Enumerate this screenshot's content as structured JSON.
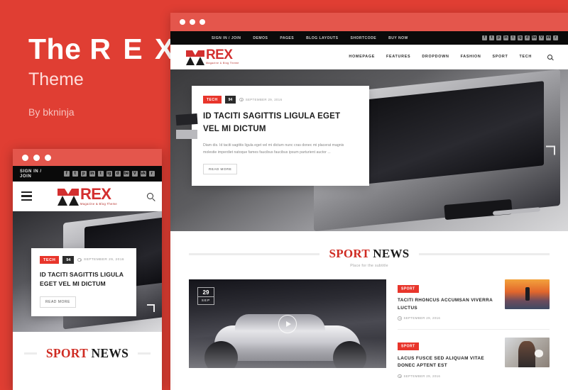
{
  "promo": {
    "title_main": "The",
    "title_brand": "R E X",
    "subtitle": "Theme",
    "author": "By bkninja"
  },
  "colors": {
    "brand_red": "#e03e33",
    "accent_red": "#e8352b",
    "logo_red": "#d32f2f",
    "dark_bar": "#0a0a0a",
    "heading_red": "#cf2b22"
  },
  "site": {
    "logo": {
      "word": "REX",
      "tagline": "Magazine & Blog Theme",
      "mark": "rex-mountain-mark"
    },
    "topbar": {
      "links": [
        {
          "label": "SIGN IN / JOIN"
        },
        {
          "label": "DEMOS"
        },
        {
          "label": "PAGES"
        },
        {
          "label": "BLOG LAYOUTS"
        },
        {
          "label": "SHORTCODE"
        },
        {
          "label": "BUY NOW"
        }
      ],
      "mobile_signin": "SIGN IN / JOIN",
      "social": [
        {
          "name": "facebook-icon",
          "glyph": "f"
        },
        {
          "name": "twitter-icon",
          "glyph": "t"
        },
        {
          "name": "pinterest-icon",
          "glyph": "p"
        },
        {
          "name": "linkedin-icon",
          "glyph": "in"
        },
        {
          "name": "tumblr-icon",
          "glyph": "t"
        },
        {
          "name": "instagram-icon",
          "glyph": "ig"
        },
        {
          "name": "dribbble-icon",
          "glyph": "d"
        },
        {
          "name": "behance-icon",
          "glyph": "be"
        },
        {
          "name": "vimeo-icon",
          "glyph": "V"
        },
        {
          "name": "vk-icon",
          "glyph": "vk"
        },
        {
          "name": "rss-icon",
          "glyph": "r"
        }
      ]
    },
    "mainnav": [
      {
        "label": "HOMEPAGE"
      },
      {
        "label": "FEATURES"
      },
      {
        "label": "DROPDOWN"
      },
      {
        "label": "FASHION"
      },
      {
        "label": "SPORT"
      },
      {
        "label": "TECH"
      }
    ],
    "search_label": "search-icon"
  },
  "hero": {
    "category": "TECH",
    "score": "94",
    "date": "SEPTEMBER 29, 2016",
    "title": "ID TACITI SAGITTIS LIGULA EGET VEL MI DICTUM",
    "excerpt": "Diam dis. Id taciti sagittis ligula eget vel mi dictum nunc cras donec mi placerat magnis molestie imperdiet natoque fames faucibus faucibus ipsum parturient auctor ...",
    "read_more": "READ MORE",
    "next_arrow": "chevron-right-icon"
  },
  "section": {
    "title_red": "SPORT",
    "title_black": "NEWS",
    "subtitle": "Place for the subtitle"
  },
  "feature": {
    "day": "29",
    "month": "SEP",
    "play": "play-button-icon",
    "image": "sports-car-night"
  },
  "side_items": [
    {
      "category": "SPORT",
      "title": "TACITI RHONCUS ACCUMSAN VIVERRA LUCTUS",
      "date": "SEPTEMBER 29, 2016",
      "thumb": "surfer-sunset"
    },
    {
      "category": "SPORT",
      "title": "LACUS FUSCE SED ALIQUAM VITAE DONEC APTENT EST",
      "date": "SEPTEMBER 29, 2016",
      "thumb": "woman-coffee"
    }
  ]
}
